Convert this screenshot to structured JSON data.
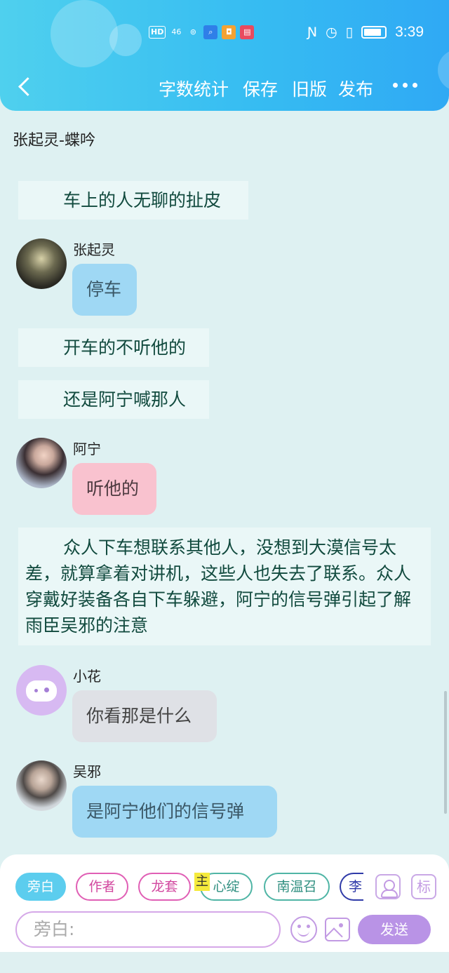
{
  "status_bar": {
    "hd_label": "HD",
    "network_label": "46",
    "time": "3:39",
    "icons": [
      "hd-icon",
      "signal-icon",
      "wifi-hotspot-icon",
      "search-app-icon",
      "cup-app-icon",
      "book-app-icon",
      "nfc-icon",
      "alarm-icon",
      "vibrate-icon",
      "battery-icon"
    ]
  },
  "header": {
    "actions": [
      "字数统计",
      "保存",
      "旧版",
      "发布"
    ]
  },
  "story_title": "张起灵-蝶吟",
  "messages": [
    {
      "type": "narration",
      "text": "车上的人无聊的扯皮"
    },
    {
      "type": "chat",
      "speaker": "张起灵",
      "text": "停车",
      "color": "#9fd8f4"
    },
    {
      "type": "narration",
      "text": "开车的不听他的"
    },
    {
      "type": "narration",
      "text": "还是阿宁喊那人"
    },
    {
      "type": "chat",
      "speaker": "阿宁",
      "text": "听他的",
      "color": "#f9c2cf"
    },
    {
      "type": "narration",
      "text": "众人下车想联系其他人，没想到大漠信号太差，就算拿着对讲机，这些人也失去了联系。众人穿戴好装备各自下车躲避，阿宁的信号弹引起了解雨臣吴邪的注意"
    },
    {
      "type": "chat",
      "speaker": "小花",
      "text": "你看那是什么",
      "color": "#dfe1e6"
    },
    {
      "type": "chat",
      "speaker": "吴邪",
      "text": "是阿宁他们的信号弹",
      "color": "#9fd8f4"
    }
  ],
  "composer": {
    "roles": [
      "旁白",
      "作者",
      "龙套",
      "心绽",
      "南温召",
      "李"
    ],
    "highlight_char": "主",
    "role_icon_label": "",
    "mark_label": "标",
    "input_placeholder": "旁白:",
    "send_label": "发送"
  },
  "colors": {
    "header_start": "#4fd0ee",
    "header_end": "#2fa9f4",
    "background": "#def1f2",
    "send_button": "#b993e6"
  }
}
